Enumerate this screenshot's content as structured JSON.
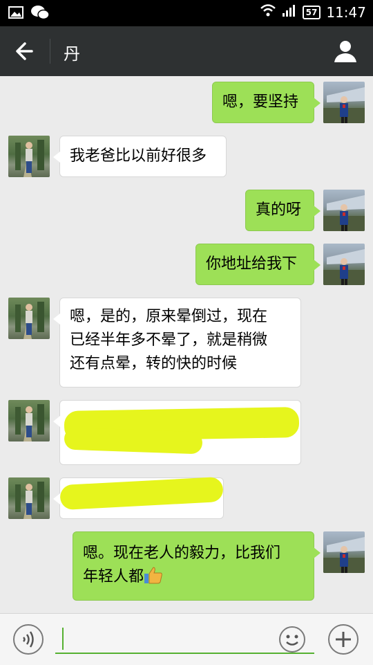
{
  "status_bar": {
    "time": "11:47",
    "battery": "57"
  },
  "header": {
    "title": "丹"
  },
  "messages": [
    {
      "side": "me",
      "text": "嗯，要坚持"
    },
    {
      "side": "them",
      "text": "我老爸比以前好很多"
    },
    {
      "side": "me",
      "text": "真的呀"
    },
    {
      "side": "me",
      "text": "你地址给我下"
    },
    {
      "side": "them",
      "lines": [
        "嗯，是的，原来晕倒过，现在",
        "已经半年多不晕了，就是稍微",
        "还有点晕，转的快的时候"
      ]
    },
    {
      "side": "them",
      "redacted": true
    },
    {
      "side": "them",
      "redacted": true
    },
    {
      "side": "me",
      "lines": [
        "嗯。现在老人的毅力，比我们",
        "年轻人都"
      ],
      "emoji": "thumbs-up-emoji"
    }
  ],
  "input": {
    "value": ""
  },
  "colors": {
    "my_bubble": "#9de057",
    "their_bubble": "#ffffff",
    "header": "#2e3132",
    "highlight": "#e6f51d"
  }
}
